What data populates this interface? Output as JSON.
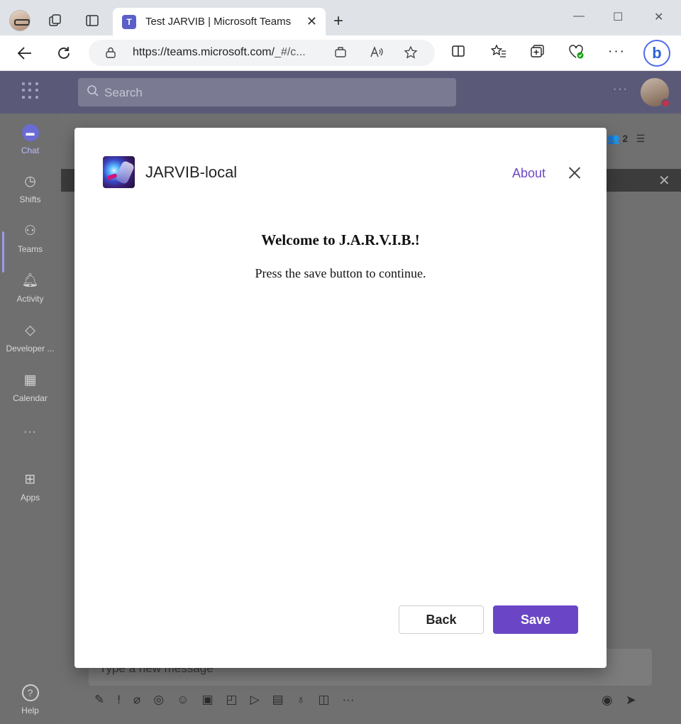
{
  "browser": {
    "tab_title": "Test JARVIB | Microsoft Teams",
    "tab_close": "✕",
    "new_tab": "+",
    "url_host": "https://teams.microsoft.com/",
    "url_rest": "_#/c...",
    "window_controls": {
      "minimize": "—",
      "maximize": "☐",
      "close": "✕"
    }
  },
  "teams": {
    "search_placeholder": "Search",
    "more": "···",
    "rail": [
      {
        "label": "Chat",
        "icon": "chat-icon"
      },
      {
        "label": "Shifts",
        "icon": "shifts-icon"
      },
      {
        "label": "Teams",
        "icon": "teams-icon"
      },
      {
        "label": "Activity",
        "icon": "bell-icon"
      },
      {
        "label": "Developer ...",
        "icon": "developer-portal-icon"
      },
      {
        "label": "Calendar",
        "icon": "calendar-icon"
      },
      {
        "label": "···",
        "icon": "more-icon"
      },
      {
        "label": "Apps",
        "icon": "apps-icon"
      },
      {
        "label": "Help",
        "icon": "help-icon"
      }
    ],
    "participants_count": "2",
    "compose_placeholder": "Type a new message"
  },
  "dialog": {
    "app_name": "JARVIB-local",
    "about": "About",
    "welcome": "Welcome to J.A.R.V.I.B.!",
    "instructions": "Press the save button to continue.",
    "back_label": "Back",
    "save_label": "Save",
    "accent_color": "#6a46c6"
  }
}
